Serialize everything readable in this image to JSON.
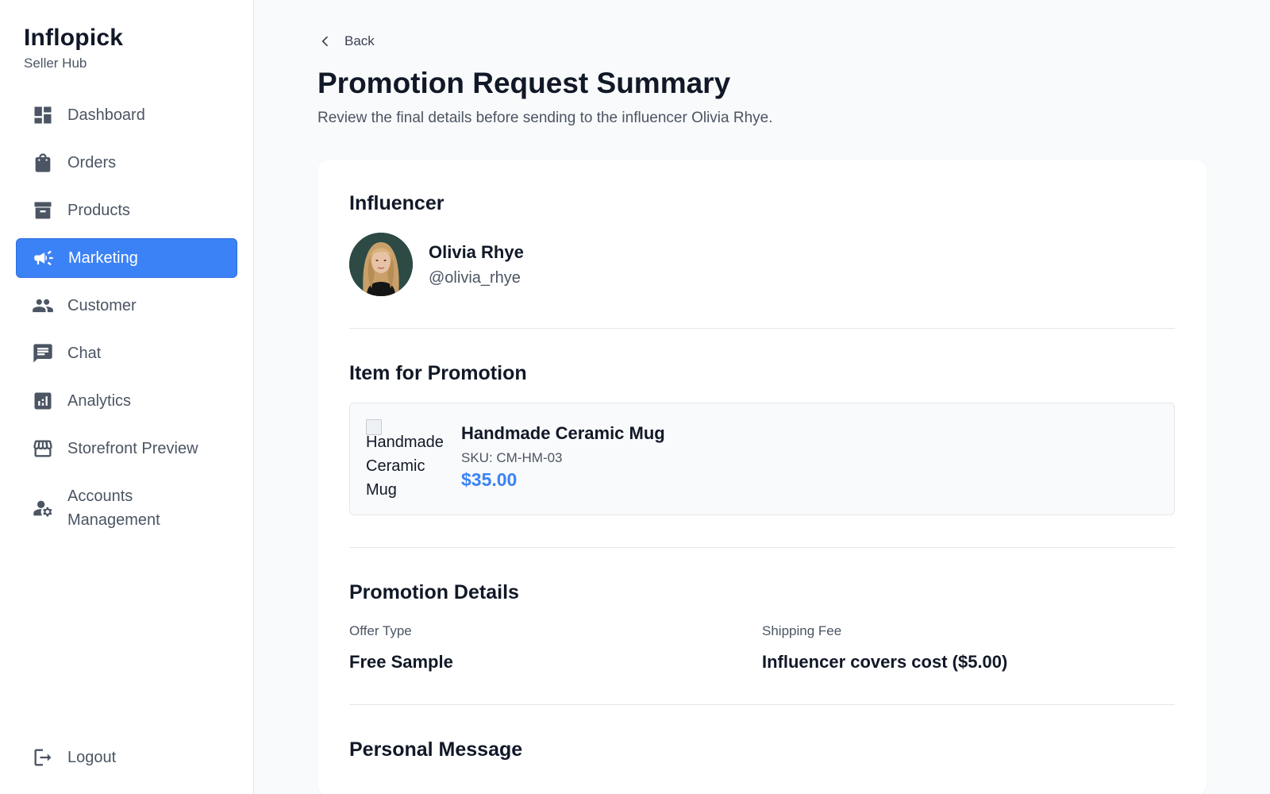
{
  "brand": {
    "title": "Inflopick",
    "subtitle": "Seller Hub"
  },
  "sidebar": {
    "items": [
      {
        "label": "Dashboard",
        "icon": "dashboard-icon"
      },
      {
        "label": "Orders",
        "icon": "shopping-bag-icon"
      },
      {
        "label": "Products",
        "icon": "archive-box-icon"
      },
      {
        "label": "Marketing",
        "icon": "megaphone-icon",
        "active": true
      },
      {
        "label": "Customer",
        "icon": "people-icon"
      },
      {
        "label": "Chat",
        "icon": "chat-icon"
      },
      {
        "label": "Analytics",
        "icon": "bar-chart-icon"
      },
      {
        "label": "Storefront Preview",
        "icon": "storefront-icon"
      },
      {
        "label": "Accounts Management",
        "icon": "user-gear-icon"
      }
    ],
    "logout": {
      "label": "Logout",
      "icon": "logout-icon"
    }
  },
  "main": {
    "back_label": "Back",
    "title": "Promotion Request Summary",
    "subtitle": "Review the final details before sending to the influencer Olivia Rhye."
  },
  "influencer": {
    "section_title": "Influencer",
    "name": "Olivia Rhye",
    "handle": "@olivia_rhye"
  },
  "item": {
    "section_title": "Item for Promotion",
    "image_alt": "Handmade Ceramic Mug",
    "name": "Handmade Ceramic Mug",
    "sku": "SKU: CM-HM-03",
    "price": "$35.00"
  },
  "promotion": {
    "section_title": "Promotion Details",
    "offer_type_label": "Offer Type",
    "offer_type_value": "Free Sample",
    "shipping_label": "Shipping Fee",
    "shipping_value": "Influencer covers cost ($5.00)"
  },
  "message": {
    "section_title": "Personal Message"
  },
  "colors": {
    "accent": "#3b82f6",
    "text": "#111827",
    "muted": "#4b5563",
    "background": "#f9fafb"
  }
}
